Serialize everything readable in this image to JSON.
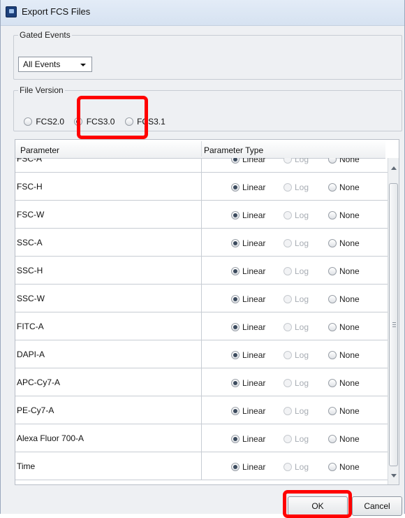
{
  "window": {
    "title": "Export FCS Files"
  },
  "gated_events": {
    "legend": "Gated Events",
    "selected": "All Events"
  },
  "file_version": {
    "legend": "File Version",
    "options": [
      {
        "label": "FCS2.0",
        "checked": false
      },
      {
        "label": "FCS3.0",
        "checked": true
      },
      {
        "label": "FCS3.1",
        "checked": false
      }
    ]
  },
  "table": {
    "headers": {
      "parameter": "Parameter",
      "type": "Parameter Type"
    },
    "option_labels": {
      "linear": "Linear",
      "log": "Log",
      "none": "None"
    },
    "rows": [
      {
        "name": "FSC-A",
        "selected": "Linear"
      },
      {
        "name": "FSC-H",
        "selected": "Linear"
      },
      {
        "name": "FSC-W",
        "selected": "Linear"
      },
      {
        "name": "SSC-A",
        "selected": "Linear"
      },
      {
        "name": "SSC-H",
        "selected": "Linear"
      },
      {
        "name": "SSC-W",
        "selected": "Linear"
      },
      {
        "name": "FITC-A",
        "selected": "Linear"
      },
      {
        "name": "DAPI-A",
        "selected": "Linear"
      },
      {
        "name": "APC-Cy7-A",
        "selected": "Linear"
      },
      {
        "name": "PE-Cy7-A",
        "selected": "Linear"
      },
      {
        "name": "Alexa Fluor 700-A",
        "selected": "Linear"
      },
      {
        "name": "Time",
        "selected": "Linear"
      }
    ]
  },
  "buttons": {
    "ok": "OK",
    "cancel": "Cancel"
  },
  "colors": {
    "highlight": "#ff0000",
    "titlebar": "#d6e2f1"
  }
}
